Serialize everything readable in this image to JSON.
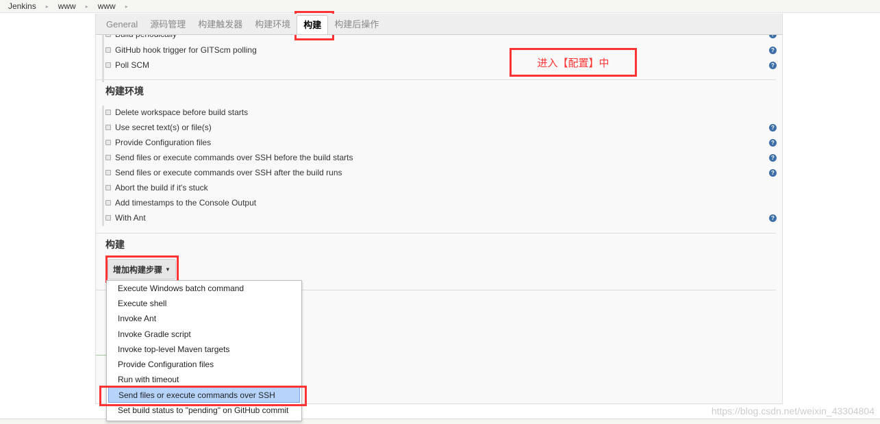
{
  "breadcrumb": [
    "Jenkins",
    "www",
    "www"
  ],
  "tabs": [
    {
      "label": "General"
    },
    {
      "label": "源码管理"
    },
    {
      "label": "构建触发器"
    },
    {
      "label": "构建环境"
    },
    {
      "label": "构建",
      "active": true
    },
    {
      "label": "构建后操作"
    }
  ],
  "triggers": [
    {
      "label": "Build periodically",
      "help": true
    },
    {
      "label": "GitHub hook trigger for GITScm polling",
      "help": true
    },
    {
      "label": "Poll SCM",
      "help": true
    }
  ],
  "annotation": "进入【配置】中",
  "env_section": {
    "title": "构建环境",
    "items": [
      {
        "label": "Delete workspace before build starts",
        "help": false
      },
      {
        "label": "Use secret text(s) or file(s)",
        "help": true
      },
      {
        "label": "Provide Configuration files",
        "help": true
      },
      {
        "label": "Send files or execute commands over SSH before the build starts",
        "help": true
      },
      {
        "label": "Send files or execute commands over SSH after the build runs",
        "help": true
      },
      {
        "label": "Abort the build if it's stuck",
        "help": false
      },
      {
        "label": "Add timestamps to the Console Output",
        "help": false
      },
      {
        "label": "With Ant",
        "help": true
      }
    ]
  },
  "build_section": {
    "title": "构建",
    "add_step_label": "增加构建步骤"
  },
  "menu": {
    "items": [
      "Execute Windows batch command",
      "Execute shell",
      "Invoke Ant",
      "Invoke Gradle script",
      "Invoke top-level Maven targets",
      "Provide Configuration files",
      "Run with timeout",
      "Send files or execute commands over SSH",
      "Set build status to \"pending\" on GitHub commit"
    ],
    "selected": "Send files or execute commands over SSH"
  },
  "watermark": "https://blog.csdn.net/weixin_43304804",
  "colors": {
    "highlight": "#ff3333",
    "selected_bg": "#b6d4fb"
  }
}
